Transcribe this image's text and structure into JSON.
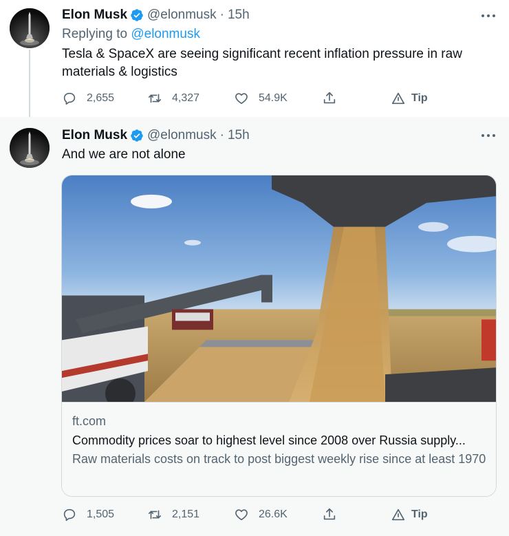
{
  "tweets": [
    {
      "author_name": "Elon Musk",
      "handle": "@elonmusk",
      "separator": "·",
      "time": "15h",
      "replying_label": "Replying to",
      "replying_to": "@elonmusk",
      "text": "Tesla & SpaceX are seeing significant recent inflation pressure in raw materials & logistics",
      "stats": {
        "replies": "2,655",
        "retweets": "4,327",
        "likes": "54.9K",
        "tip_label": "Tip"
      }
    },
    {
      "author_name": "Elon Musk",
      "handle": "@elonmusk",
      "separator": "·",
      "time": "15h",
      "text": "And we are not alone",
      "card": {
        "domain": "ft.com",
        "title": "Commodity prices soar to highest level since 2008 over Russia supply...",
        "description": "Raw materials costs on track to post biggest weekly rise since at least 1970"
      },
      "stats": {
        "replies": "1,505",
        "retweets": "2,151",
        "likes": "26.6K",
        "tip_label": "Tip"
      }
    }
  ],
  "colors": {
    "accent": "#1d9bf0",
    "secondary_text": "#536471",
    "primary_text": "#0f1419",
    "border": "#cfd9de",
    "highlight_bg": "#f7f9f9"
  },
  "icons": [
    "avatar-rocket",
    "verified-badge-icon",
    "more-icon",
    "reply-icon",
    "retweet-icon",
    "like-icon",
    "share-icon",
    "tip-icon"
  ]
}
